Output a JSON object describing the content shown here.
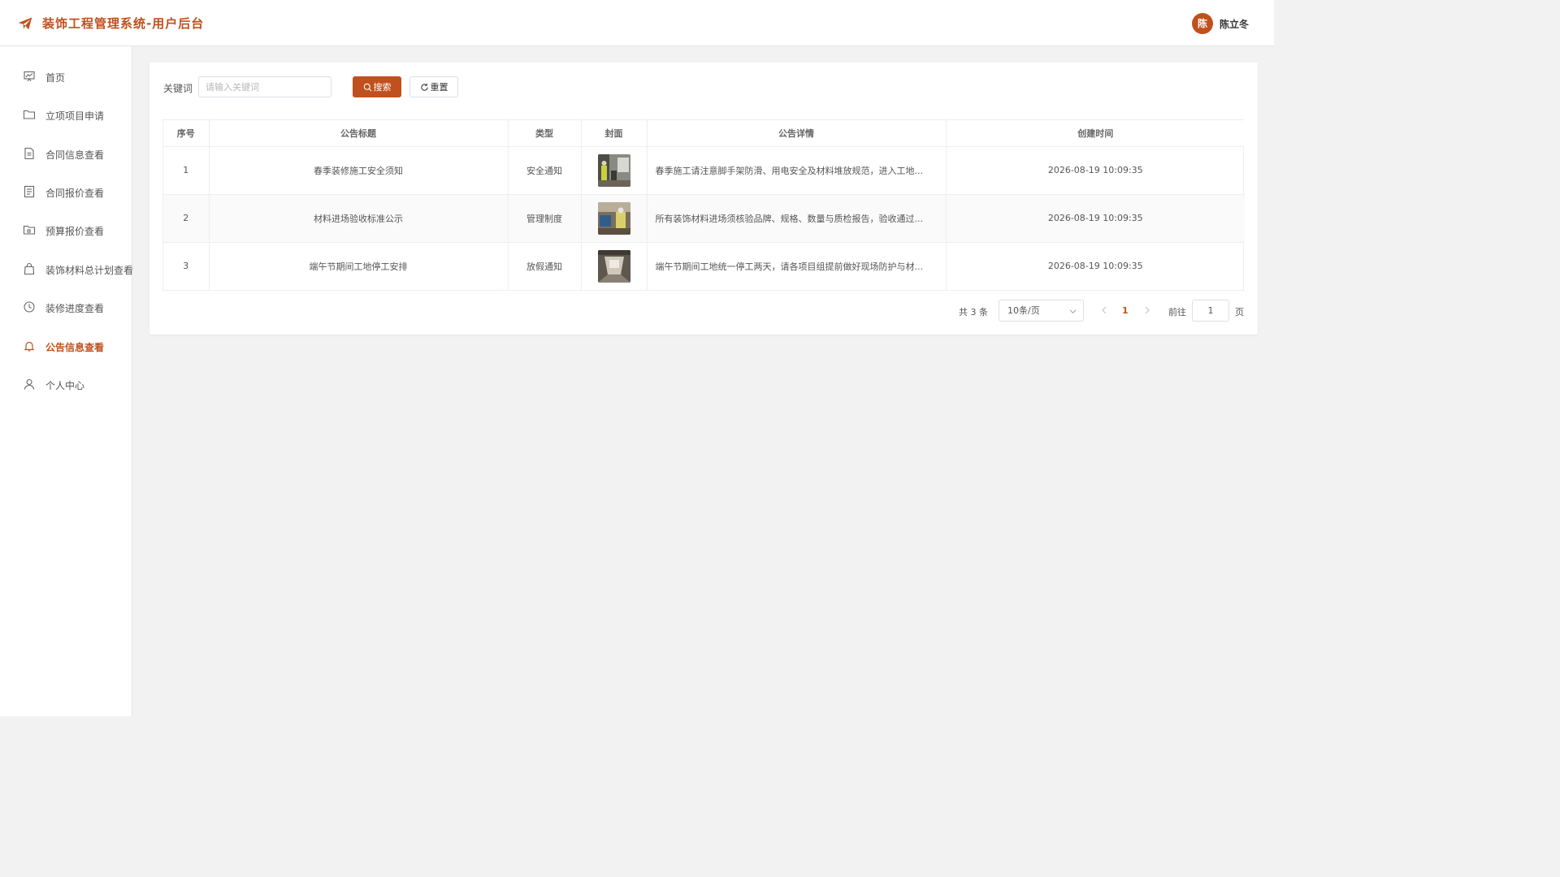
{
  "header": {
    "title": "装饰工程管理系统-用户后台",
    "avatar_char": "陈",
    "username": "陈立冬",
    "accent_color": "#c0501d"
  },
  "sidebar": {
    "items": [
      {
        "label": "首页",
        "icon": "dashboard-icon"
      },
      {
        "label": "立项项目申请",
        "icon": "folder-icon"
      },
      {
        "label": "合同信息查看",
        "icon": "document-icon"
      },
      {
        "label": "合同报价查看",
        "icon": "list-document-icon"
      },
      {
        "label": "预算报价查看",
        "icon": "folder-add-icon"
      },
      {
        "label": "装饰材料总计划查看",
        "icon": "shopping-bag-icon"
      },
      {
        "label": "装修进度查看",
        "icon": "clock-icon"
      },
      {
        "label": "公告信息查看",
        "icon": "bell-icon",
        "active": true
      },
      {
        "label": "个人中心",
        "icon": "user-icon"
      }
    ]
  },
  "search": {
    "label": "关键词",
    "placeholder": "请输入关键词",
    "value": "",
    "search_label": "搜索",
    "reset_label": "重置"
  },
  "table": {
    "columns": [
      "序号",
      "公告标题",
      "类型",
      "封面",
      "公告详情",
      "创建时间"
    ],
    "rows": [
      {
        "index": "1",
        "title": "春季装修施工安全须知",
        "type": "安全通知",
        "cover": "construction-photo",
        "detail": "春季施工请注意脚手架防滑、用电安全及材料堆放规范，进入工地...",
        "created": "2026-08-19 10:09:35"
      },
      {
        "index": "2",
        "title": "材料进场验收标准公示",
        "type": "管理制度",
        "cover": "worker-photo",
        "detail": "所有装饰材料进场须核验品牌、规格、数量与质检报告，验收通过...",
        "created": "2026-08-19 10:09:35"
      },
      {
        "index": "3",
        "title": "端午节期间工地停工安排",
        "type": "放假通知",
        "cover": "empty-room-photo",
        "detail": "端午节期间工地统一停工两天，请各项目组提前做好现场防护与材...",
        "created": "2026-08-19 10:09:35"
      }
    ]
  },
  "pagination": {
    "total": "共 3 条",
    "page_size": "10条/页",
    "current_page": "1",
    "goto_label": "前往",
    "goto_value": "1",
    "page_suffix": "页"
  }
}
